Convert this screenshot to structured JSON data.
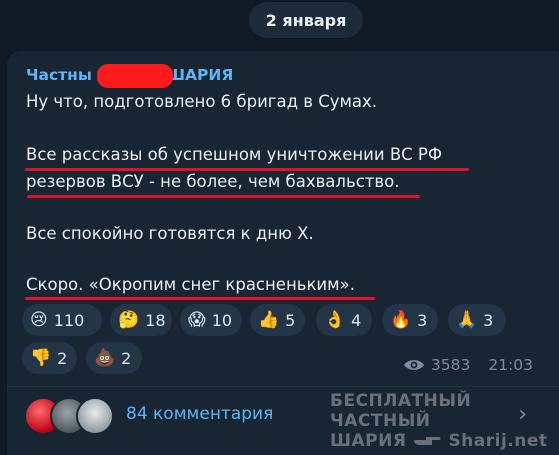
{
  "date_label": "2 января",
  "post": {
    "author_prefix": "Частны",
    "author_suffix": "ШАРИЯ",
    "lines": [
      "Ну что, подготовлено 6 бригад в Сумах.",
      "Все рассказы об успешном уничтожении ВС РФ",
      "резервов ВСУ - не более, чем бахвальство.",
      "Все спокойно готовятся к дню Х.",
      "Скоро. «Окропим снег красненьким»."
    ]
  },
  "reactions": [
    {
      "emoji": "😢",
      "count": "110"
    },
    {
      "emoji": "🤔",
      "count": "18"
    },
    {
      "emoji": "😱",
      "count": "10"
    },
    {
      "emoji": "👍",
      "count": "5"
    },
    {
      "emoji": "👌",
      "count": "4"
    },
    {
      "emoji": "🔥",
      "count": "3"
    },
    {
      "emoji": "🙏",
      "count": "3"
    },
    {
      "emoji": "👎",
      "count": "2"
    },
    {
      "emoji": "💩",
      "count": "2"
    }
  ],
  "views": "3583",
  "time": "21:03",
  "comments_label": "84 комментария",
  "watermark": {
    "line1": "БЕСПЛАТНЫЙ ЧАСТНЫЙ",
    "line2_word": "ШАРИЯ",
    "line2_site": "Sharij.net"
  },
  "icons": {
    "views": "eye-icon",
    "chevron": "chevron-right-icon",
    "watermark_hand": "pointing-hand-icon"
  },
  "colors": {
    "background": "#0f1a24",
    "bubble": "#182533",
    "accent": "#5eb5f7",
    "censor": "#ff1b1b",
    "underline": "#e0112b"
  }
}
